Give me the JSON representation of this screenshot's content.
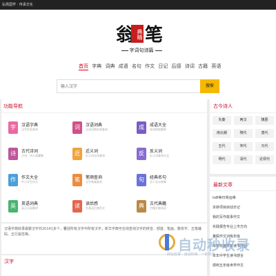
{
  "topbar": {
    "text": "弘扬国学 · 传承文化"
  },
  "logo": {
    "chars": [
      "翁",
      "笔"
    ],
    "seal": "典精",
    "tagline": "字词句诗篇"
  },
  "nav": [
    "首页",
    "字典",
    "词典",
    "成语",
    "名句",
    "作文",
    "日记",
    "后感",
    "诗词",
    "古籍",
    "英语"
  ],
  "search": {
    "placeholder": "输入汉字",
    "button": "搜索"
  },
  "functions": {
    "title": "功能导航",
    "items": [
      {
        "name": "汉语字典",
        "desc": "汉字信息查询",
        "icon": "字",
        "color": "#e96aa3"
      },
      {
        "name": "汉语词典",
        "desc": "汉语词典在线查询",
        "icon": "词",
        "color": "#d14f8a"
      },
      {
        "name": "成语大全",
        "desc": "成语典故解释",
        "icon": "成",
        "color": "#7c5cc4"
      },
      {
        "name": "古代诗词",
        "desc": "古诗、诗人收藏集",
        "icon": "诗",
        "color": "#c0569b"
      },
      {
        "name": "近义词",
        "desc": "近义词在线查询",
        "icon": "近",
        "color": "#f0a33c"
      },
      {
        "name": "反义词",
        "desc": "反义词查询大全",
        "icon": "反",
        "color": "#8a6bd1"
      },
      {
        "name": "作文大全",
        "desc": "中小学生作文",
        "icon": "作",
        "color": "#4aa0d8"
      },
      {
        "name": "笔顺查询",
        "desc": "汉字笔顺查询",
        "icon": "笔",
        "color": "#ee8b3c"
      },
      {
        "name": "经典名句",
        "desc": "名人名句收集",
        "icon": "句",
        "color": "#6b72d8"
      },
      {
        "name": "英语词典",
        "desc": "英汉汉英翻译",
        "icon": "英",
        "color": "#48b56e"
      },
      {
        "name": "读后感",
        "desc": "名著读后感范文",
        "icon": "读",
        "color": "#e5664f"
      },
      {
        "name": "古代典籍",
        "desc": "古籍文献阅读",
        "icon": "典",
        "color": "#b98a45"
      }
    ]
  },
  "intro": {
    "text": "汉语字典收录最繁汉字共20141多个，囊括所有汉字中所有汉字，新华字典可在线查询汉字的拼音、部首、笔画、繁体字、五笔编码、五行属性等。"
  },
  "hanzi": {
    "title": "汉字"
  },
  "poets": {
    "title": "古今诗人",
    "dynasties": [
      "先秦",
      "两汉",
      "魏晋",
      "南北朝",
      "隋代",
      "唐代",
      "五代",
      "宋代",
      "元代",
      "明代",
      "清代",
      "近现代"
    ]
  },
  "articles": {
    "title": "最新文章",
    "items": [
      "toB等日常运维",
      "本转项目启动日记",
      "我的写作故事作文",
      "实践报告专业上市方向",
      "暑假作文训练年级",
      "本学年度校友读书作业",
      "本年中学生读书感言",
      "感到五年级世界作文"
    ]
  },
  "watermark": {
    "text": "自动秒收录",
    "sub": "网址收录 · 自动秒收 · 一秒搞定"
  }
}
